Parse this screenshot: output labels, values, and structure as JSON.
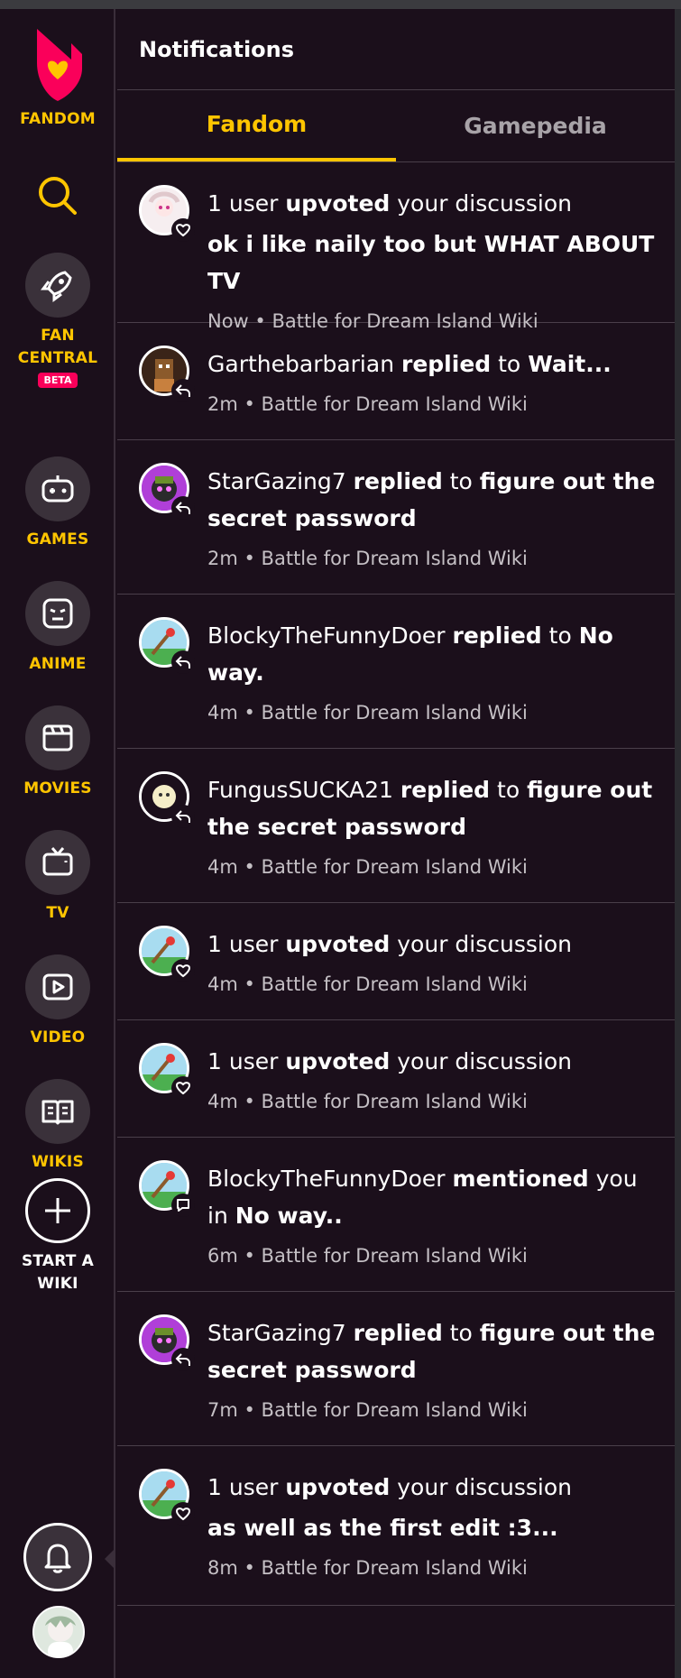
{
  "sidebar": {
    "logo_label": "FANDOM",
    "items": [
      {
        "label": "FAN CENTRAL",
        "badge": "BETA"
      },
      {
        "label": "GAMES"
      },
      {
        "label": "ANIME"
      },
      {
        "label": "MOVIES"
      },
      {
        "label": "TV"
      },
      {
        "label": "VIDEO"
      },
      {
        "label": "WIKIS"
      },
      {
        "label": "START A WIKI"
      }
    ]
  },
  "panel": {
    "title": "Notifications",
    "tabs": [
      "Fandom",
      "Gamepedia"
    ],
    "notifications": [
      {
        "actor": "1 user",
        "action": "upvoted",
        "tail": "your discussion",
        "snippet": "ok i like naily too but WHAT ABOUT TV",
        "meta": "Now • Battle for Dream Island Wiki",
        "badge_icon": "heart-icon",
        "avatar": "girl"
      },
      {
        "actor": "Garthebarbarian",
        "action": "replied",
        "to": "to",
        "target": "Wait...",
        "meta": "2m • Battle for Dream Island Wiki",
        "badge_icon": "reply-icon",
        "avatar": "brown"
      },
      {
        "actor": "StarGazing7",
        "action": "replied",
        "to": "to",
        "target": "figure out the secret password",
        "meta": "2m • Battle for Dream Island Wiki",
        "badge_icon": "reply-icon",
        "avatar": "purple"
      },
      {
        "actor": "BlockyTheFunnyDoer",
        "action": "replied",
        "to": "to",
        "target": "No way.",
        "meta": "4m • Battle for Dream Island Wiki",
        "badge_icon": "reply-icon",
        "avatar": "sky"
      },
      {
        "actor": "FungusSUCKA21",
        "action": "replied",
        "to": "to",
        "target": "figure out the secret password",
        "meta": "4m • Battle for Dream Island Wiki",
        "badge_icon": "reply-icon",
        "avatar": "dark"
      },
      {
        "actor": "1 user",
        "action": "upvoted",
        "tail": "your discussion",
        "meta": "4m • Battle for Dream Island Wiki",
        "badge_icon": "heart-icon",
        "avatar": "sky"
      },
      {
        "actor": "1 user",
        "action": "upvoted",
        "tail": "your discussion",
        "meta": "4m • Battle for Dream Island Wiki",
        "badge_icon": "heart-icon",
        "avatar": "sky"
      },
      {
        "actor": "BlockyTheFunnyDoer",
        "action": "mentioned",
        "to": "you in",
        "target": "No way..",
        "meta": "6m • Battle for Dream Island Wiki",
        "badge_icon": "comment-icon",
        "avatar": "sky"
      },
      {
        "actor": "StarGazing7",
        "action": "replied",
        "to": "to",
        "target": "figure out the secret password",
        "meta": "7m • Battle for Dream Island Wiki",
        "badge_icon": "reply-icon",
        "avatar": "purple"
      },
      {
        "actor": "1 user",
        "action": "upvoted",
        "tail": "your discussion",
        "snippet": "as well as the first edit :3...",
        "meta": "8m • Battle for Dream Island Wiki",
        "badge_icon": "heart-icon",
        "avatar": "sky"
      }
    ]
  },
  "colors": {
    "accent": "#ffc500",
    "bg": "#1b0f1b",
    "brand": "#fa005a"
  }
}
